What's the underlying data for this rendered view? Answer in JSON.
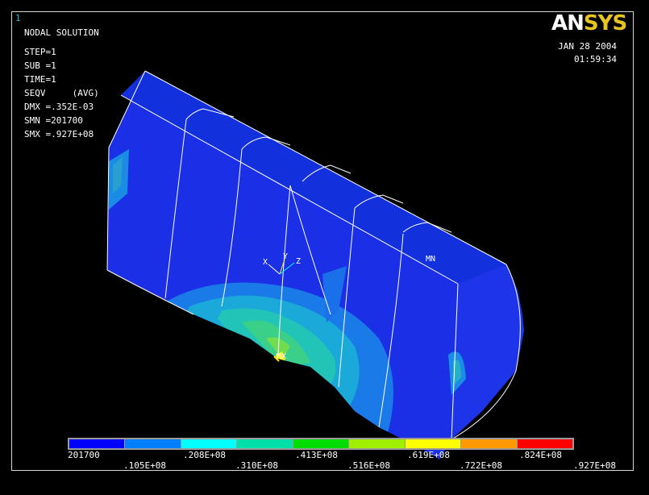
{
  "window_number": "1",
  "logo": {
    "part1": "AN",
    "part2": "SYS"
  },
  "info": {
    "title": "NODAL SOLUTION",
    "step": "STEP=1",
    "sub": "SUB =1",
    "time": "TIME=1",
    "seqv": "SEQV     (AVG)",
    "dmx": "DMX =.352E-03",
    "smn": "SMN =201700",
    "smx": "SMX =.927E+08"
  },
  "date": "JAN 28 2004",
  "time_of_day": "01:59:34",
  "markers": {
    "mn": "MN",
    "mx": "MX"
  },
  "axes": {
    "x": "X",
    "y": "Y",
    "z": "Z"
  },
  "legend": {
    "colors": [
      "#0000ff",
      "#0080ff",
      "#00ffff",
      "#00e0a8",
      "#00dd00",
      "#a0ee00",
      "#ffff00",
      "#ff9900",
      "#ff0000"
    ],
    "labels_top": [
      "201700",
      ".208E+08",
      ".413E+08",
      ".619E+08",
      ".824E+08"
    ],
    "labels_bottom": [
      ".105E+08",
      ".310E+08",
      ".516E+08",
      ".722E+08",
      ".927E+08"
    ]
  }
}
